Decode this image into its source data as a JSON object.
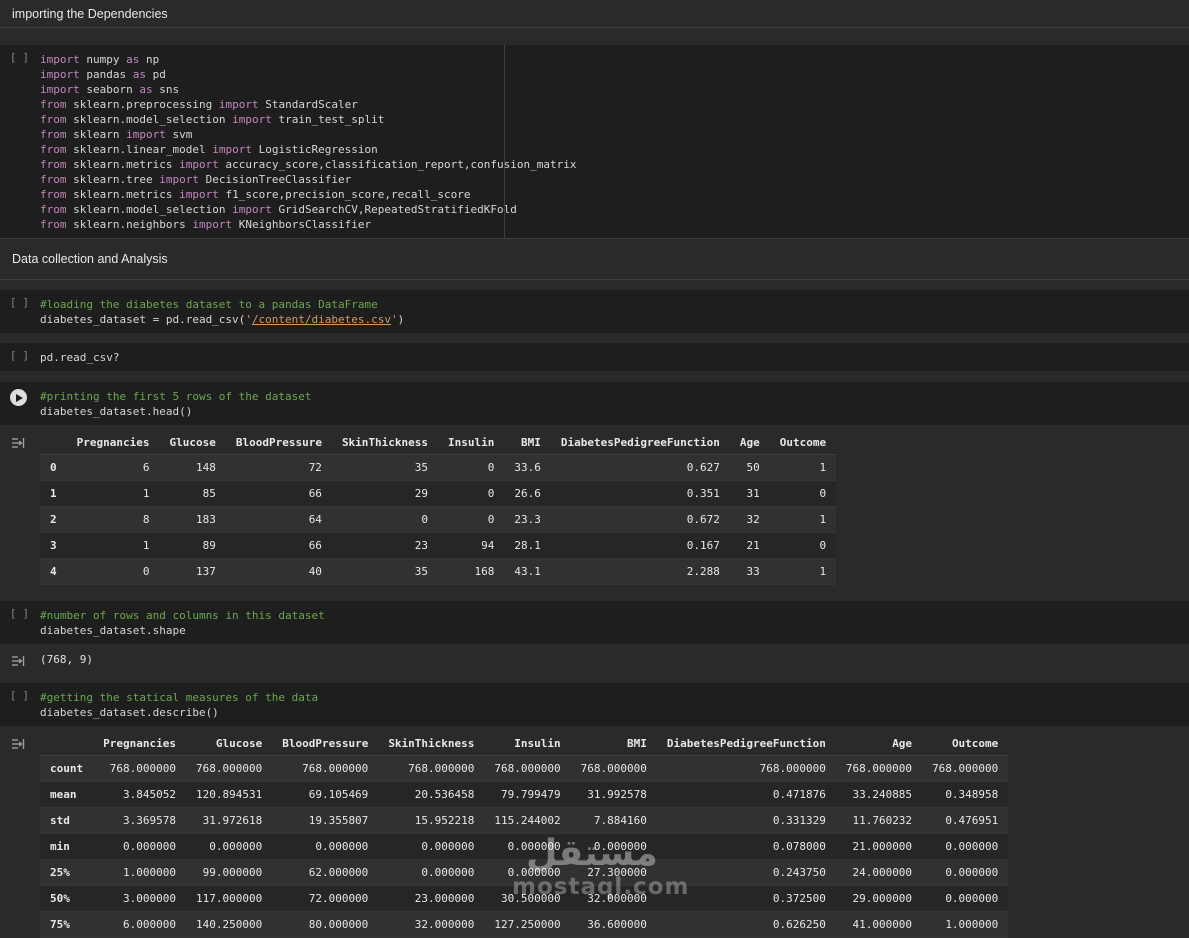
{
  "headings": {
    "dependencies": "importing the Dependencies",
    "data_collection": "Data collection and Analysis"
  },
  "labels": {
    "empty_prompt": "[ ]"
  },
  "cells": {
    "imports": [
      "import numpy as np",
      "import pandas as pd",
      "import seaborn as sns",
      "from sklearn.preprocessing import StandardScaler",
      "from sklearn.model_selection import train_test_split",
      "from sklearn import svm",
      "from sklearn.linear_model import LogisticRegression",
      "from sklearn.metrics import accuracy_score,classification_report,confusion_matrix",
      "from sklearn.tree import DecisionTreeClassifier",
      "from sklearn.metrics import f1_score,precision_score,recall_score",
      "from sklearn.model_selection import GridSearchCV,RepeatedStratifiedKFold",
      "from sklearn.neighbors import KNeighborsClassifier"
    ],
    "load": [
      "#loading the diabetes dataset to a pandas DataFrame",
      "diabetes_dataset = pd.read_csv('/content/diabetes.csv')"
    ],
    "help": [
      "pd.read_csv?"
    ],
    "head": [
      "#printing the first 5 rows of the dataset",
      "diabetes_dataset.head()"
    ],
    "shape": [
      "#number of rows and columns in this dataset",
      "diabetes_dataset.shape"
    ],
    "describe": [
      "#getting the statical measures of the data",
      "diabetes_dataset.describe()"
    ]
  },
  "outputs": {
    "shape_text": "(768, 9)",
    "head_table": {
      "columns": [
        "",
        "Pregnancies",
        "Glucose",
        "BloodPressure",
        "SkinThickness",
        "Insulin",
        "BMI",
        "DiabetesPedigreeFunction",
        "Age",
        "Outcome"
      ],
      "rows": [
        [
          "0",
          "6",
          "148",
          "72",
          "35",
          "0",
          "33.6",
          "0.627",
          "50",
          "1"
        ],
        [
          "1",
          "1",
          "85",
          "66",
          "29",
          "0",
          "26.6",
          "0.351",
          "31",
          "0"
        ],
        [
          "2",
          "8",
          "183",
          "64",
          "0",
          "0",
          "23.3",
          "0.672",
          "32",
          "1"
        ],
        [
          "3",
          "1",
          "89",
          "66",
          "23",
          "94",
          "28.1",
          "0.167",
          "21",
          "0"
        ],
        [
          "4",
          "0",
          "137",
          "40",
          "35",
          "168",
          "43.1",
          "2.288",
          "33",
          "1"
        ]
      ]
    },
    "describe_table": {
      "columns": [
        "",
        "Pregnancies",
        "Glucose",
        "BloodPressure",
        "SkinThickness",
        "Insulin",
        "BMI",
        "DiabetesPedigreeFunction",
        "Age",
        "Outcome"
      ],
      "rows": [
        [
          "count",
          "768.000000",
          "768.000000",
          "768.000000",
          "768.000000",
          "768.000000",
          "768.000000",
          "768.000000",
          "768.000000",
          "768.000000"
        ],
        [
          "mean",
          "3.845052",
          "120.894531",
          "69.105469",
          "20.536458",
          "79.799479",
          "31.992578",
          "0.471876",
          "33.240885",
          "0.348958"
        ],
        [
          "std",
          "3.369578",
          "31.972618",
          "19.355807",
          "15.952218",
          "115.244002",
          "7.884160",
          "0.331329",
          "11.760232",
          "0.476951"
        ],
        [
          "min",
          "0.000000",
          "0.000000",
          "0.000000",
          "0.000000",
          "0.000000",
          "0.000000",
          "0.078000",
          "21.000000",
          "0.000000"
        ],
        [
          "25%",
          "1.000000",
          "99.000000",
          "62.000000",
          "0.000000",
          "0.000000",
          "27.300000",
          "0.243750",
          "24.000000",
          "0.000000"
        ],
        [
          "50%",
          "3.000000",
          "117.000000",
          "72.000000",
          "23.000000",
          "30.500000",
          "32.000000",
          "0.372500",
          "29.000000",
          "0.000000"
        ],
        [
          "75%",
          "6.000000",
          "140.250000",
          "80.000000",
          "32.000000",
          "127.250000",
          "36.600000",
          "0.626250",
          "41.000000",
          "1.000000"
        ]
      ]
    }
  },
  "watermark": {
    "arabic": "مستقل",
    "latin": "mostaql.com"
  },
  "syntax_colors": {
    "keyword": "#c586c0",
    "comment": "#6aa84f",
    "string": "#d19a66"
  }
}
